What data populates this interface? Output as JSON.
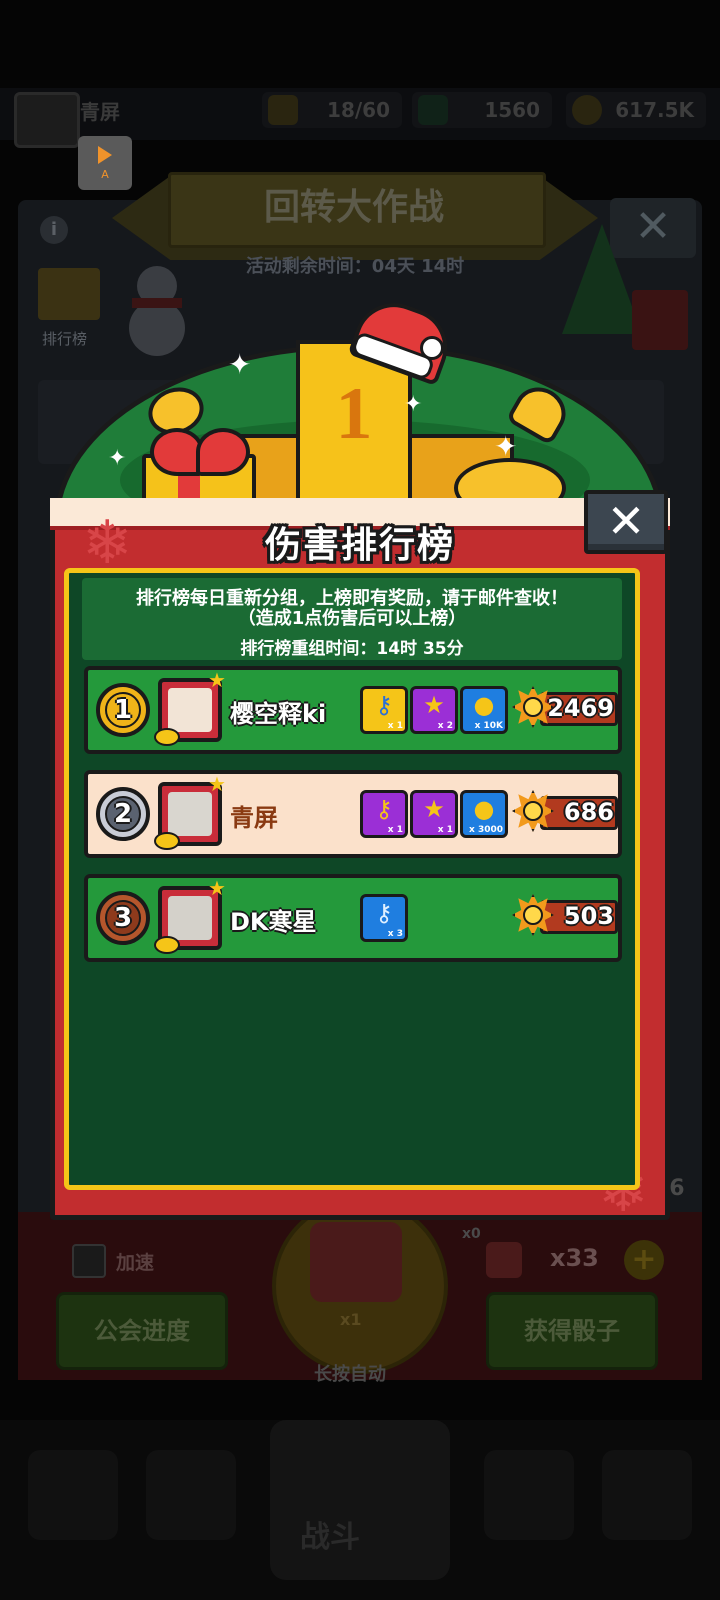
{
  "background": {
    "player_name": "青屏",
    "energy": "18/60",
    "gems": "1560",
    "coins": "617.5K",
    "replay_label": "A",
    "event_title": "回转大作战",
    "event_timer": "活动剩余时间：04天 14时",
    "info_glyph": "i",
    "leaderboard_label": "排行榜",
    "close_glyph": "✕",
    "speed_label": "加速",
    "guild_progress_button": "公会进度",
    "get_dice_button": "获得骰子",
    "roll_multiplier": "x1",
    "long_press_label": "长按自动",
    "extra_count": "x0",
    "dice_count": "x33",
    "add_glyph": "+",
    "side_number": "36",
    "nav_center_label": "战斗"
  },
  "modal": {
    "title": "伤害排行榜",
    "close_glyph": "✕",
    "notice_line1": "排行榜每日重新分组，上榜即有奖励，请于邮件查收！",
    "notice_line2": "（造成1点伤害后可以上榜）",
    "reset_time": "排行榜重组时间：14时 35分",
    "podium_number": "1",
    "rows": [
      {
        "rank": "1",
        "name": "樱空释ki",
        "score": "2469",
        "rewards": [
          {
            "icon": "key-icon",
            "glyph": "⚷",
            "qty": "x 1"
          },
          {
            "icon": "ticket-icon",
            "glyph": "★",
            "qty": "x 2"
          },
          {
            "icon": "coin-icon",
            "glyph": "●",
            "qty": "x 10K"
          }
        ]
      },
      {
        "rank": "2",
        "name": "青屏",
        "score": "686",
        "rewards": [
          {
            "icon": "key-icon",
            "glyph": "⚷",
            "qty": "x 1"
          },
          {
            "icon": "ticket-icon",
            "glyph": "★",
            "qty": "x 1"
          },
          {
            "icon": "coin-icon",
            "glyph": "●",
            "qty": "x 3000"
          }
        ]
      },
      {
        "rank": "3",
        "name": "DK寒星",
        "score": "503",
        "rewards": [
          {
            "icon": "key-icon",
            "glyph": "⚷",
            "qty": "x 3"
          }
        ]
      }
    ]
  },
  "colors": {
    "modal_red": "#c22d2f",
    "panel_green": "#0e4726",
    "row_green": "#24993b",
    "row_peach": "#fbe1cb",
    "gold_border": "#f5c518",
    "medal_gold": "#f0b419",
    "medal_silver": "#c8ccd6",
    "medal_bronze": "#b5562c"
  }
}
